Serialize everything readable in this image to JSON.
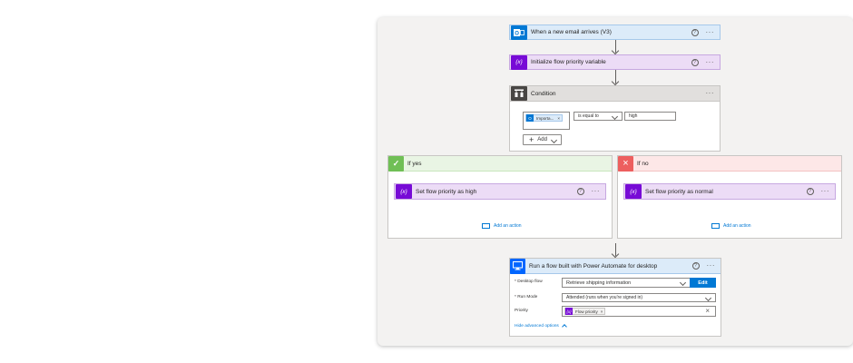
{
  "colors": {
    "outlook": "#0078d4",
    "variable": "#770bd6",
    "condition": "#484644",
    "yes": "#70bf56",
    "no": "#ed5f5f",
    "desktop": "#0066ff",
    "link": "#0078d4"
  },
  "trigger": {
    "title": "When a new email arrives (V3)",
    "icon": "outlook-icon"
  },
  "init_var": {
    "title": "Initialize flow priority variable",
    "icon": "variable-icon",
    "icon_glyph": "{x}"
  },
  "condition": {
    "title": "Condition",
    "icon": "condition-icon",
    "token_label": "Importa...",
    "operator": "is equal to",
    "value": "high",
    "add_label": "Add"
  },
  "if_yes": {
    "label": "If yes",
    "action_title": "Set flow priority as high",
    "add_action": "Add an action"
  },
  "if_no": {
    "label": "If no",
    "action_title": "Set flow priority as normal",
    "add_action": "Add an action"
  },
  "run_flow": {
    "title": "Run a flow built with Power Automate for desktop",
    "icon": "desktop-flow-icon",
    "fields": {
      "desktop_flow_label": "* Desktop flow",
      "desktop_flow_value": "Retrieve shipping information",
      "edit_label": "Edit",
      "run_mode_label": "* Run Mode",
      "run_mode_value": "Attended (runs when you're signed in)",
      "priority_label": "Priority",
      "priority_token": "Flow priority"
    },
    "hide_advanced": "Hide advanced options"
  },
  "glyphs": {
    "help": "?",
    "more": "···",
    "close": "×",
    "check": "✓",
    "plus": "+"
  }
}
